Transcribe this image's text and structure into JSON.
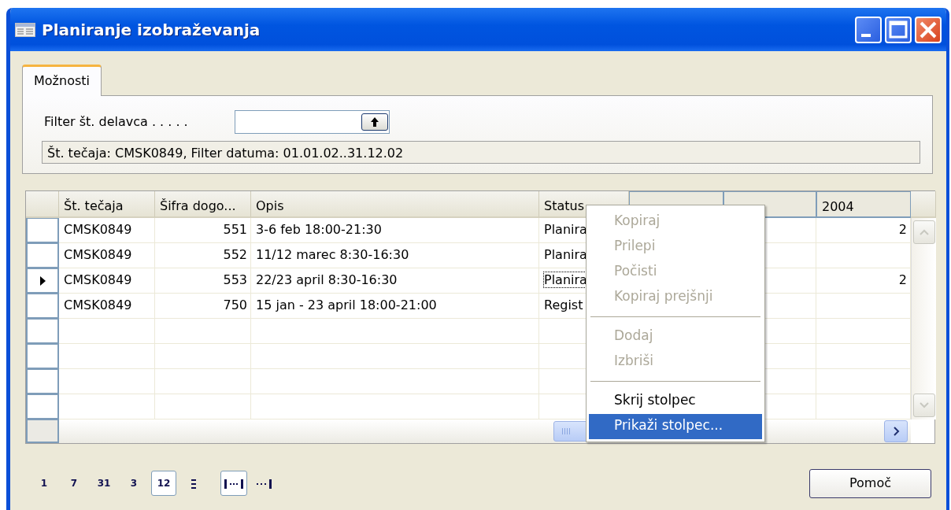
{
  "window": {
    "title": "Planiranje izobraževanja"
  },
  "tabs": [
    {
      "label": "Možnosti",
      "selected": true
    }
  ],
  "filter": {
    "label": "Filter št. delavca . . . . ."
  },
  "info": "Št. tečaja: CMSK0849, Filter datuma: 01.01.02..31.12.02",
  "table": {
    "columns": [
      "Št. tečaja",
      "Šifra dogo...",
      "Opis",
      "Status"
    ],
    "year_column": "2004",
    "rows": [
      {
        "current": false,
        "cells": [
          "CMSK0849",
          "551",
          "3-6 feb 18:00-21:30",
          "Planira"
        ],
        "year_value": "2"
      },
      {
        "current": false,
        "cells": [
          "CMSK0849",
          "552",
          "11/12 marec 8:30-16:30",
          "Planira"
        ]
      },
      {
        "current": true,
        "cells": [
          "CMSK0849",
          "553",
          "22/23 april 8:30-16:30",
          "Planira"
        ],
        "year_value": "2"
      },
      {
        "current": false,
        "cells": [
          "CMSK0849",
          "750",
          "15 jan - 23 april 18:00-21:00",
          "Regist"
        ]
      }
    ]
  },
  "context_menu": [
    {
      "kind": "item",
      "label": "Kopiraj",
      "disabled": true,
      "selected": false
    },
    {
      "kind": "item",
      "label": "Prilepi",
      "disabled": true,
      "selected": false
    },
    {
      "kind": "item",
      "label": "Počisti",
      "disabled": true,
      "selected": false
    },
    {
      "kind": "item",
      "label": "Kopiraj prejšnji",
      "disabled": true,
      "selected": false
    },
    {
      "kind": "separator"
    },
    {
      "kind": "item",
      "label": "Dodaj",
      "disabled": true,
      "selected": false
    },
    {
      "kind": "item",
      "label": "Izbriši",
      "disabled": true,
      "selected": false
    },
    {
      "kind": "separator"
    },
    {
      "kind": "item",
      "label": "Skrij stolpec",
      "disabled": false,
      "selected": false
    },
    {
      "kind": "item",
      "label": "Prikaži stolpec...",
      "disabled": false,
      "selected": true
    }
  ],
  "periods": [
    {
      "label": "1",
      "selected": false
    },
    {
      "label": "7",
      "selected": false
    },
    {
      "label": "31",
      "selected": false
    },
    {
      "label": "3",
      "selected": false
    },
    {
      "label": "12",
      "selected": true
    }
  ],
  "range_buttons": [
    {
      "selected": true
    },
    {
      "selected": false
    }
  ],
  "help_button": "Pomoč"
}
